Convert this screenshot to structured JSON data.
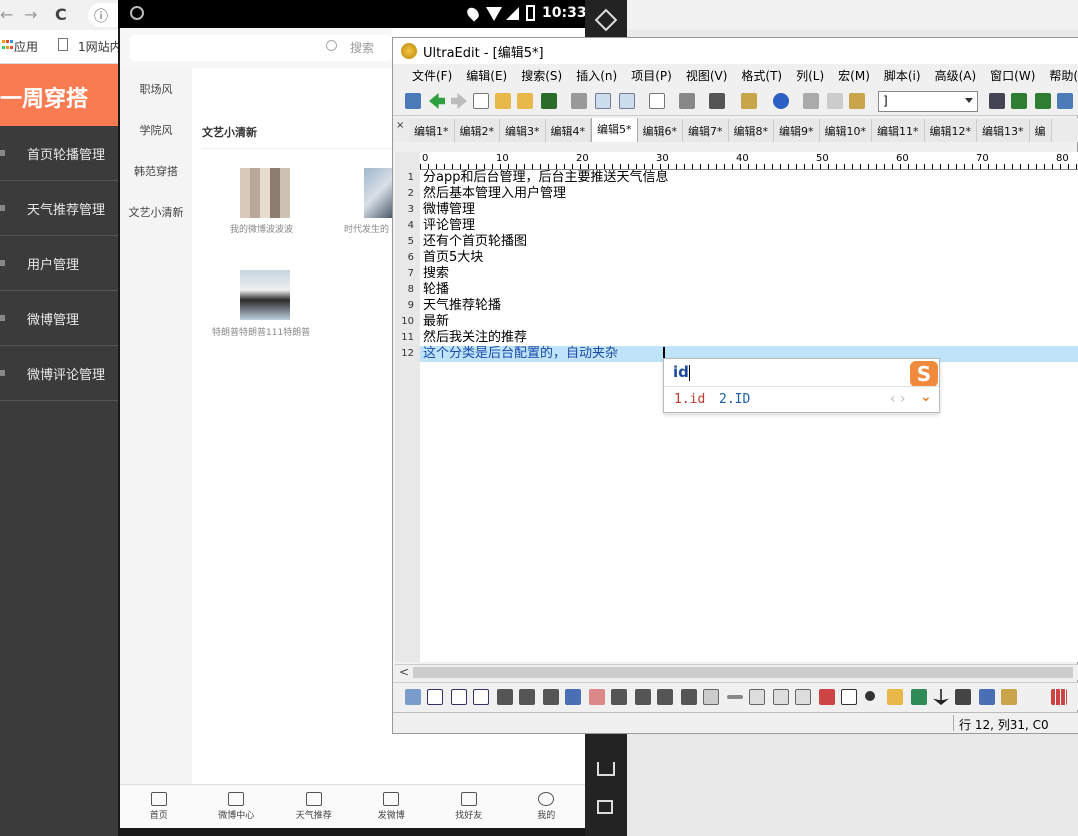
{
  "browser": {
    "back": "←",
    "forward": "→",
    "reload": "C",
    "info": "ⓘ",
    "apps_label": "应用",
    "bookmark_label": "1网站内"
  },
  "admin": {
    "banner": "一周穿搭",
    "menu": [
      "首页轮播管理",
      "天气推荐管理",
      "用户管理",
      "微博管理",
      "微博评论管理"
    ]
  },
  "phone": {
    "time": "10:33",
    "search_placeholder": "搜索",
    "categories": [
      "职场风",
      "学院风",
      "韩范穿搭",
      "文艺小清新"
    ],
    "section_title": "文艺小清新",
    "items": [
      "我的微博波波波",
      "时代发生的",
      "特朗普特朗普111特朗普"
    ],
    "tabs": [
      "首页",
      "微博中心",
      "天气推荐",
      "发微博",
      "找好友",
      "我的"
    ]
  },
  "ultraedit": {
    "title": "UltraEdit - [编辑5*]",
    "menu": [
      "文件(F)",
      "编辑(E)",
      "搜索(S)",
      "插入(n)",
      "项目(P)",
      "视图(V)",
      "格式(T)",
      "列(L)",
      "宏(M)",
      "脚本(i)",
      "高级(A)",
      "窗口(W)",
      "帮助(H"
    ],
    "combo_value": "]",
    "file_tabs": [
      "编辑1*",
      "编辑2*",
      "编辑3*",
      "编辑4*",
      "编辑5*",
      "编辑6*",
      "编辑7*",
      "编辑8*",
      "编辑9*",
      "编辑10*",
      "编辑11*",
      "编辑12*",
      "编辑13*",
      "编"
    ],
    "active_tab_index": 4,
    "ruler_labels": [
      "0",
      "10",
      "20",
      "30",
      "40",
      "50",
      "60",
      "70",
      "80"
    ],
    "lines": [
      "分app和后台管理，后台主要推送天气信息",
      "然后基本管理入用户管理",
      "微博管理",
      "评论管理",
      "还有个首页轮播图",
      "首页5大块",
      "搜索",
      "轮播",
      "天气推荐轮播",
      "最新",
      "然后我关注的推荐",
      "这个分类是后台配置的，自动夹杂"
    ],
    "line_numbers": [
      "1",
      "2",
      "3",
      "4",
      "5",
      "6",
      "7",
      "8",
      "9",
      "10",
      "11",
      "12"
    ],
    "status": "行 12, 列31, C0",
    "hscroll_left": "<"
  },
  "ime": {
    "input": "id",
    "candidates": [
      "1.id",
      "2.ID"
    ],
    "logo": "S",
    "nav": "‹ ›",
    "expand": "⌄"
  },
  "colors": {
    "banner": "#f87b52",
    "sidebar": "#3b3b3b",
    "selection": "#bfe3f8",
    "ime_candidate": "#c0392b"
  }
}
